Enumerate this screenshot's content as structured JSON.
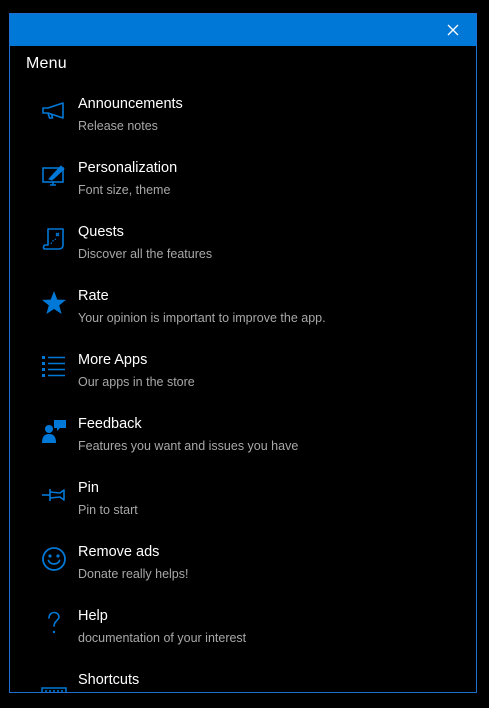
{
  "window": {
    "accent_color": "#0078d7",
    "close_icon": "close-icon"
  },
  "menu": {
    "title": "Menu",
    "items": [
      {
        "label": "Announcements",
        "sub": "Release notes",
        "icon": "megaphone-icon"
      },
      {
        "label": "Personalization",
        "sub": "Font size, theme",
        "icon": "personalize-icon"
      },
      {
        "label": "Quests",
        "sub": "Discover all the features",
        "icon": "map-icon"
      },
      {
        "label": "Rate",
        "sub": "Your opinion is important to improve the app.",
        "icon": "star-icon"
      },
      {
        "label": "More Apps",
        "sub": "Our apps in the store",
        "icon": "list-icon"
      },
      {
        "label": "Feedback",
        "sub": "Features you want and issues you have",
        "icon": "feedback-icon"
      },
      {
        "label": "Pin",
        "sub": "Pin to start",
        "icon": "pin-icon"
      },
      {
        "label": "Remove ads",
        "sub": "Donate really helps!",
        "icon": "smiley-icon"
      },
      {
        "label": "Help",
        "sub": "documentation of your interest",
        "icon": "question-icon"
      },
      {
        "label": "Shortcuts",
        "sub": "",
        "icon": "keyboard-icon"
      }
    ]
  }
}
